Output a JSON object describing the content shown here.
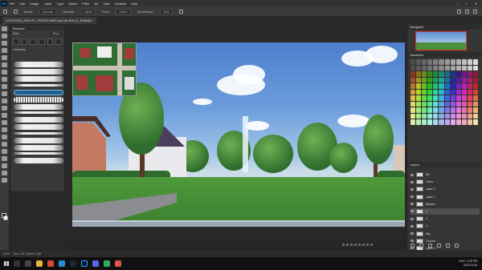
{
  "menubar": {
    "app_logo": "Ps",
    "items": [
      "File",
      "Edit",
      "Image",
      "Layer",
      "Type",
      "Select",
      "Filter",
      "3D",
      "View",
      "Window",
      "Help"
    ],
    "window_controls": [
      "minimize-icon",
      "maximize-icon",
      "close-icon"
    ]
  },
  "optionsbar": {
    "mode_label": "Mode:",
    "mode_value": "Normal",
    "opacity_label": "Opacity:",
    "opacity_value": "100%",
    "flow_label": "Flow:",
    "flow_value": "100%",
    "smoothing_label": "Smoothing:",
    "smoothing_value": "10%"
  },
  "document": {
    "tab_title": "LOCATION_EIGHTY_FRONTYARD.psd @ 50% (1, RGB/8) *"
  },
  "brushes_panel": {
    "title": "Brushes",
    "size_label": "Size:",
    "size_value": "60 px",
    "folder_label": "Brushes"
  },
  "right_panels": {
    "navigator_title": "Navigator",
    "swatches_title": "Swatches",
    "layers_title": "Layers",
    "layers": [
      {
        "name": "BG",
        "selected": false
      },
      {
        "name": "Trees",
        "selected": false
      },
      {
        "name": "Layer 2",
        "selected": false
      },
      {
        "name": "Layer 1",
        "selected": false
      },
      {
        "name": "Bushes",
        "selected": false
      },
      {
        "name": "1",
        "selected": true
      },
      {
        "name": "2",
        "selected": false
      },
      {
        "name": "3",
        "selected": false
      },
      {
        "name": "Sky",
        "selected": false
      },
      {
        "name": "Ground",
        "selected": false
      },
      {
        "name": "Layer 0",
        "selected": false
      }
    ]
  },
  "statusbar": {
    "zoom": "50%",
    "doc_info": "Doc: 24.7M/397.3M"
  },
  "taskbar": {
    "language": "ENG",
    "time": "2:35 PM",
    "date": "2021/11/15"
  },
  "colors": {
    "accent": "#31a8ff",
    "sky_top": "#4e7fcd",
    "grass": "#4f9a3c"
  }
}
